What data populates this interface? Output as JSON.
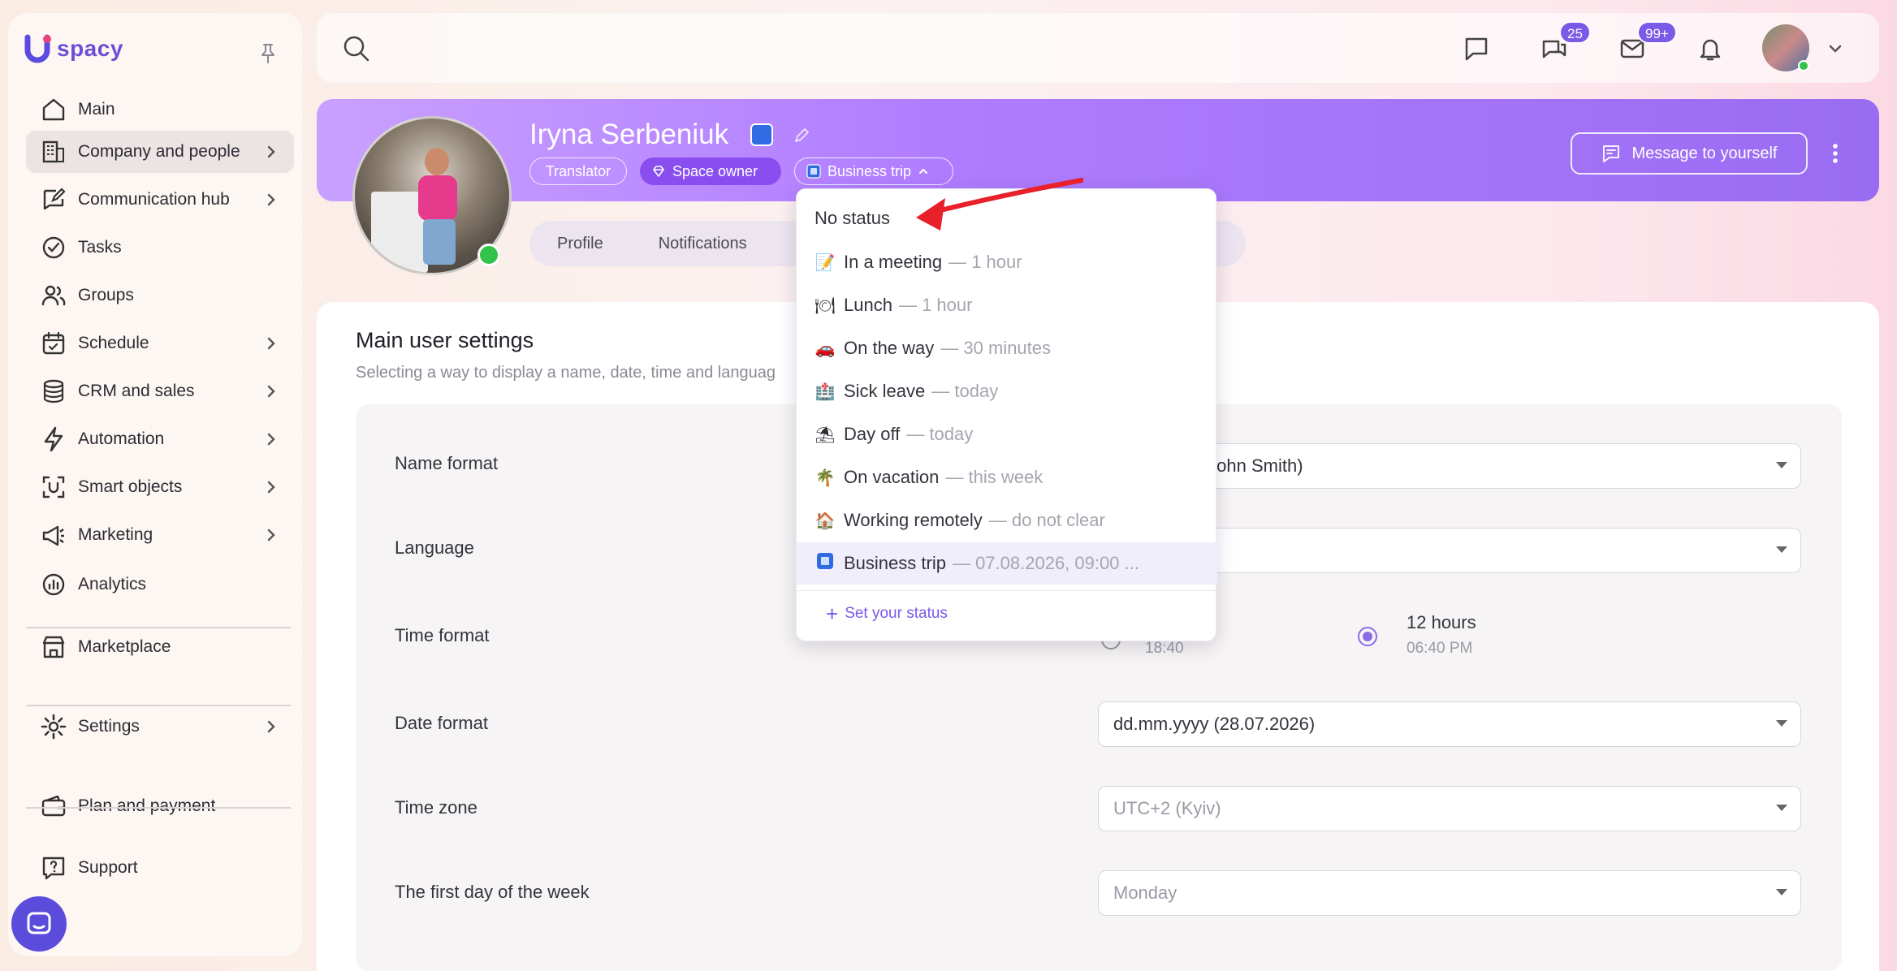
{
  "app": {
    "logo_text": "spacy",
    "logo_letter": "U",
    "brand_color": "#6b4ed6",
    "accent_color": "#7a5ae6"
  },
  "sidebar": {
    "items": [
      {
        "label": "Main",
        "icon": "home-icon",
        "chevron": false,
        "active": false
      },
      {
        "label": "Company and people",
        "icon": "building-icon",
        "chevron": true,
        "active": true
      },
      {
        "label": "Communication hub",
        "icon": "edit-chat-icon",
        "chevron": true,
        "active": false
      },
      {
        "label": "Tasks",
        "icon": "check-circle-icon",
        "chevron": false,
        "active": false
      },
      {
        "label": "Groups",
        "icon": "users-icon",
        "chevron": false,
        "active": false
      },
      {
        "label": "Schedule",
        "icon": "calendar-icon",
        "chevron": true,
        "active": false
      },
      {
        "label": "CRM and sales",
        "icon": "coins-icon",
        "chevron": true,
        "active": false
      },
      {
        "label": "Automation",
        "icon": "lightning-icon",
        "chevron": true,
        "active": false
      },
      {
        "label": "Smart objects",
        "icon": "scan-icon",
        "chevron": true,
        "active": false
      },
      {
        "label": "Marketing",
        "icon": "megaphone-icon",
        "chevron": true,
        "active": false
      },
      {
        "label": "Analytics",
        "icon": "chart-icon",
        "chevron": false,
        "active": false
      },
      {
        "label": "Marketplace",
        "icon": "store-icon",
        "chevron": false,
        "active": false
      },
      {
        "label": "Settings",
        "icon": "gear-icon",
        "chevron": true,
        "active": false
      },
      {
        "label": "Plan and payment",
        "icon": "wallet-icon",
        "chevron": false,
        "active": false
      },
      {
        "label": "Support",
        "icon": "help-icon",
        "chevron": false,
        "active": false
      }
    ]
  },
  "topbar": {
    "badges": {
      "chats": "25",
      "mail": "99+"
    }
  },
  "profile": {
    "name": "Iryna Serbeniuk",
    "tags": {
      "role": "Translator",
      "owner": "Space owner",
      "status": "Business trip"
    },
    "message_button": "Message to yourself",
    "tabs": [
      "Profile",
      "Notifications"
    ],
    "tab_partial": "s"
  },
  "settings": {
    "title": "Main user settings",
    "subtitle": "Selecting a way to display a name, date, time and languag",
    "rows": {
      "name_format": {
        "label": "Name format",
        "value": "Last name (John Smith)"
      },
      "language": {
        "label": "Language",
        "value": ""
      },
      "time_format": {
        "label": "Time format",
        "opt24_label": "s",
        "opt24_sub": "18:40",
        "opt12_label": "12 hours",
        "opt12_sub": "06:40 PM"
      },
      "date_format": {
        "label": "Date format",
        "value": "dd.mm.yyyy (28.07.2026)"
      },
      "time_zone": {
        "label": "Time zone",
        "value": "UTC+2 (Kyiv)"
      },
      "first_day": {
        "label": "The first day of the week",
        "value": "Monday"
      }
    }
  },
  "status_menu": {
    "no_status": "No status",
    "items": [
      {
        "emoji": "📝",
        "name": "In a meeting",
        "duration": "— 1 hour"
      },
      {
        "emoji": "🍽",
        "name": "Lunch",
        "duration": "— 1 hour"
      },
      {
        "emoji": "🚗",
        "name": "On the way",
        "duration": "— 30 minutes"
      },
      {
        "emoji": "🏥",
        "name": "Sick leave",
        "duration": "— today"
      },
      {
        "emoji": "⛱",
        "name": "Day off",
        "duration": "— today"
      },
      {
        "emoji": "🌴",
        "name": "On vacation",
        "duration": "— this week"
      },
      {
        "emoji": "🏠",
        "name": "Working remotely",
        "duration": "— do not clear"
      },
      {
        "emoji": "",
        "name": "Business trip",
        "duration": "— 07.08.2026, 09:00 ..."
      }
    ],
    "set_status": "Set your status"
  }
}
